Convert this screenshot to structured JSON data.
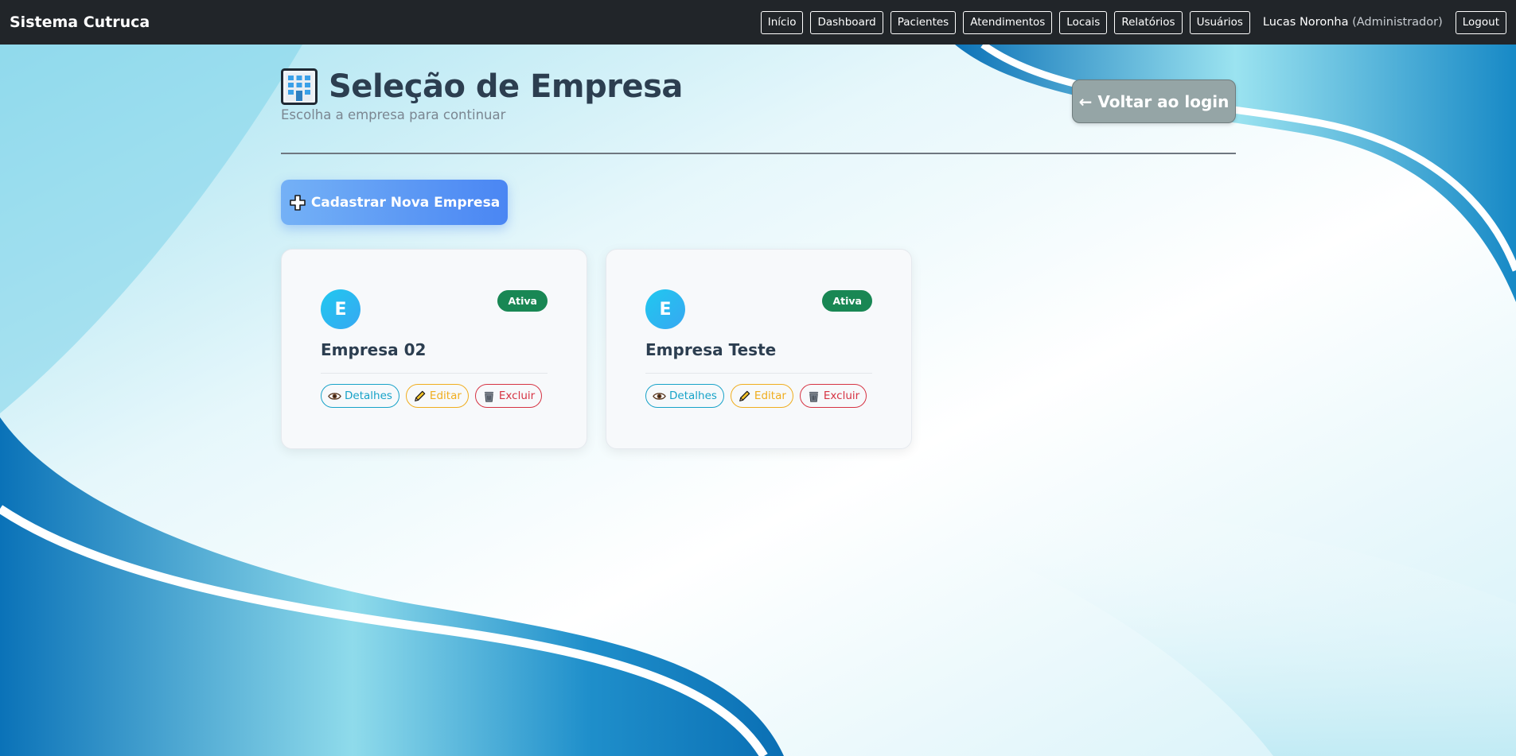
{
  "navbar": {
    "brand": "Sistema Cutruca",
    "links": [
      "Início",
      "Dashboard",
      "Pacientes",
      "Atendimentos",
      "Locais",
      "Relatórios",
      "Usuários"
    ],
    "user_name": "Lucas Noronha",
    "user_role": "(Administrador)",
    "logout_label": "Logout"
  },
  "header": {
    "title": "Seleção de Empresa",
    "subtitle": "Escolha a empresa para continuar",
    "back_label": "← Voltar ao login"
  },
  "add_company_label": "Cadastrar Nova Empresa",
  "companies": [
    {
      "initial": "E",
      "name": "Empresa 02",
      "status": "Ativa",
      "actions": {
        "details": "Detalhes",
        "edit": "Editar",
        "delete": "Excluir"
      }
    },
    {
      "initial": "E",
      "name": "Empresa Teste",
      "status": "Ativa",
      "actions": {
        "details": "Detalhes",
        "edit": "Editar",
        "delete": "Excluir"
      }
    }
  ],
  "colors": {
    "navbar_bg": "#212529",
    "title_color": "#2c3e50",
    "back_button_bg": "#95a5a6",
    "add_button_gradient": [
      "#74b1f6",
      "#4a86f3"
    ],
    "status_active_bg": "#198754",
    "details_color": "#17a2c8",
    "edit_color": "#f0ad1e",
    "delete_color": "#d63343"
  },
  "icons": {
    "page_title": "office-building-icon",
    "add_company": "plus-icon",
    "details": "eye-icon",
    "edit": "pencil-icon",
    "delete": "trash-icon"
  }
}
